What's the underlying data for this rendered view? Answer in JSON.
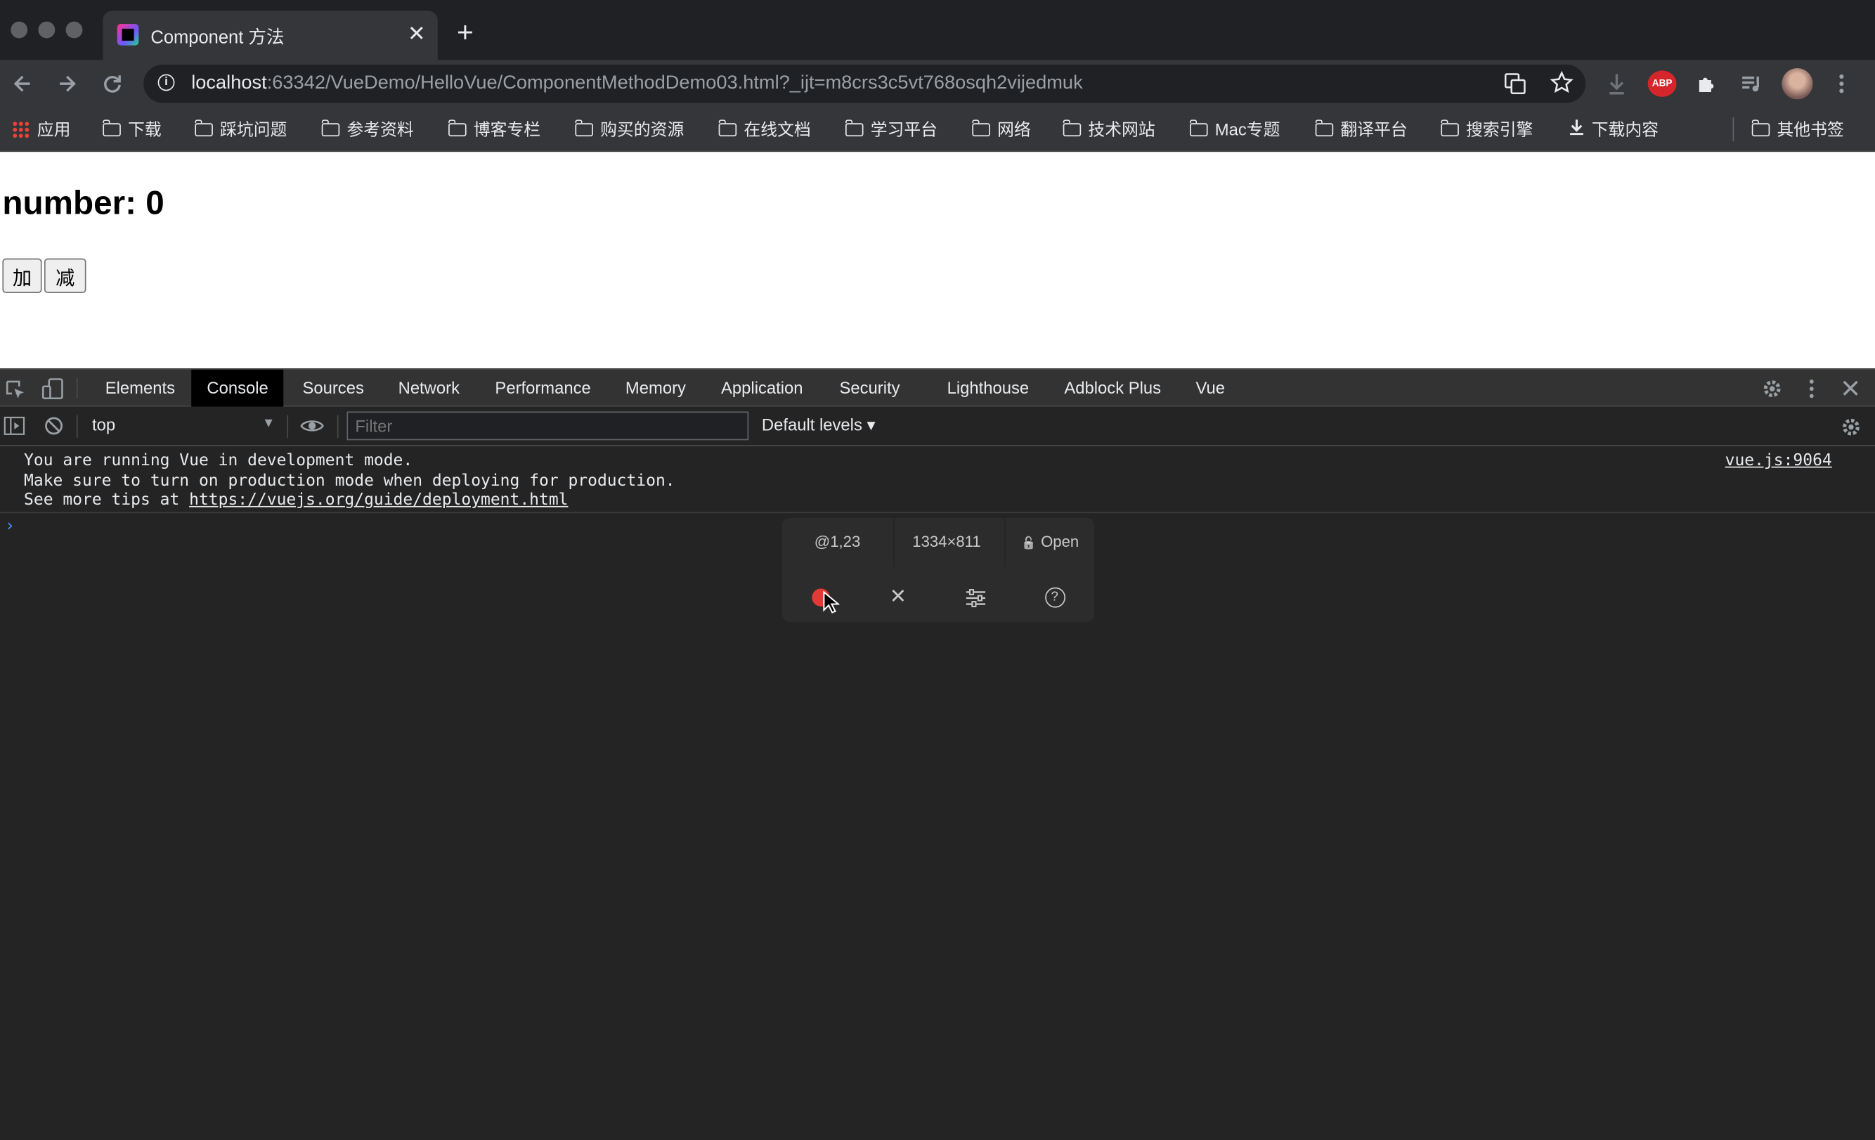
{
  "browser": {
    "tab_title": "Component 方法",
    "tab_close": "✕",
    "new_tab": "+",
    "url_host": "localhost",
    "url_rest": ":63342/VueDemo/HelloVue/ComponentMethodDemo03.html?_ijt=m8crs3c5vt768osqh2vijedmuk",
    "info_glyph": "i",
    "abp_label": "ABP",
    "icons": [
      "back-arrow-icon",
      "forward-arrow-icon",
      "reload-icon",
      "translate-icon",
      "star-icon",
      "download-icon",
      "adblock-plus-icon",
      "extensions-icon",
      "media-icon",
      "profile-avatar-icon",
      "menu-icon"
    ]
  },
  "bookmarks": {
    "apps": "应用",
    "items": [
      "下载",
      "踩坑问题",
      "参考资料",
      "博客专栏",
      "购买的资源",
      "在线文档",
      "学习平台",
      "网络",
      "技术网站",
      "Mac专题",
      "翻译平台",
      "搜索引擎"
    ],
    "downloads": "下载内容",
    "other": "其他书签"
  },
  "page": {
    "heading": "number: 0",
    "add_button": "加",
    "subtract_button": "减"
  },
  "devtools": {
    "tabs": [
      "Elements",
      "Console",
      "Sources",
      "Network",
      "Performance",
      "Memory",
      "Application",
      "Security",
      "Lighthouse",
      "Adblock Plus",
      "Vue"
    ],
    "active_tab": "Console",
    "context": "top",
    "filter_placeholder": "Filter",
    "levels": "Default levels ▾",
    "message": {
      "line1": "You are running Vue in development mode.",
      "line2": "Make sure to turn on production mode when deploying for production.",
      "line3_prefix": "See more tips at ",
      "link": "https://vuejs.org/guide/deployment.html",
      "source": "vue.js:9064"
    },
    "prompt": "›"
  },
  "recorder": {
    "position": "@1,23",
    "size": "1334×811",
    "open_label": "Open",
    "lock_glyph": "🔓",
    "close_glyph": "✕",
    "help_glyph": "?",
    "settings_glyph": "⚙"
  },
  "colors": {
    "accent_record": "#e53935",
    "prompt_blue": "#4d8ef7",
    "devtools_bg": "#242424"
  }
}
